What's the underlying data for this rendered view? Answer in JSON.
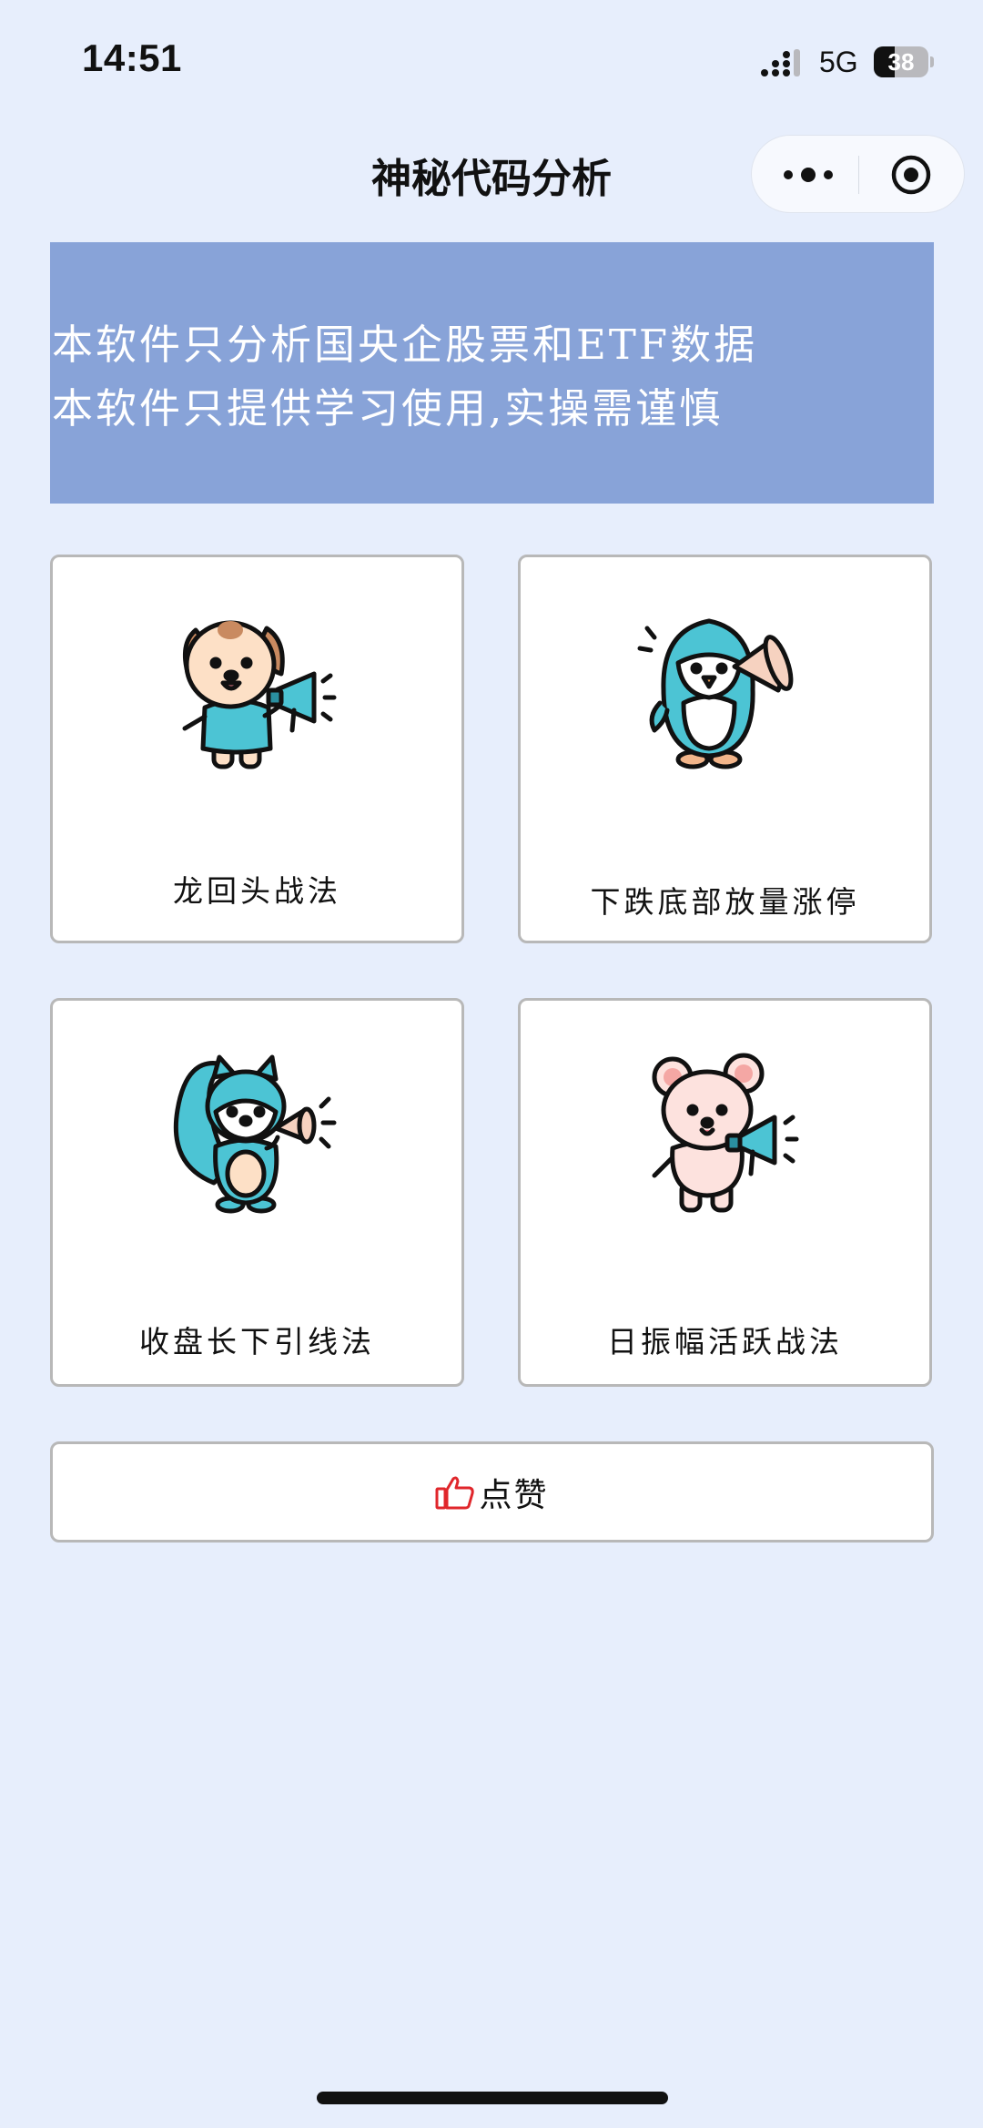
{
  "status_bar": {
    "time": "14:51",
    "network": "5G",
    "battery_level": "38",
    "battery_fraction": 0.38
  },
  "nav": {
    "title": "神秘代码分析"
  },
  "notice": {
    "lines": [
      "本软件只分析国央企股票和ETF数据",
      "本软件只提供学习使用,实操需谨慎"
    ]
  },
  "cards": [
    {
      "label": "龙回头战法",
      "icon": "dog-megaphone-icon"
    },
    {
      "label": "下跌底部放量涨停",
      "icon": "penguin-megaphone-icon"
    },
    {
      "label": "收盘长下引线法",
      "icon": "squirrel-megaphone-icon"
    },
    {
      "label": "日振幅活跃战法",
      "icon": "mouse-megaphone-icon"
    }
  ],
  "like_button": {
    "label": "点赞",
    "icon": "thumbs-up-icon"
  },
  "colors": {
    "page_background": "#e7eefc",
    "notice_background": "#88a3d8",
    "card_border": "#b8b8b8",
    "mascot_teal": "#4cc4d4",
    "thumbs_red": "#e0262b"
  }
}
